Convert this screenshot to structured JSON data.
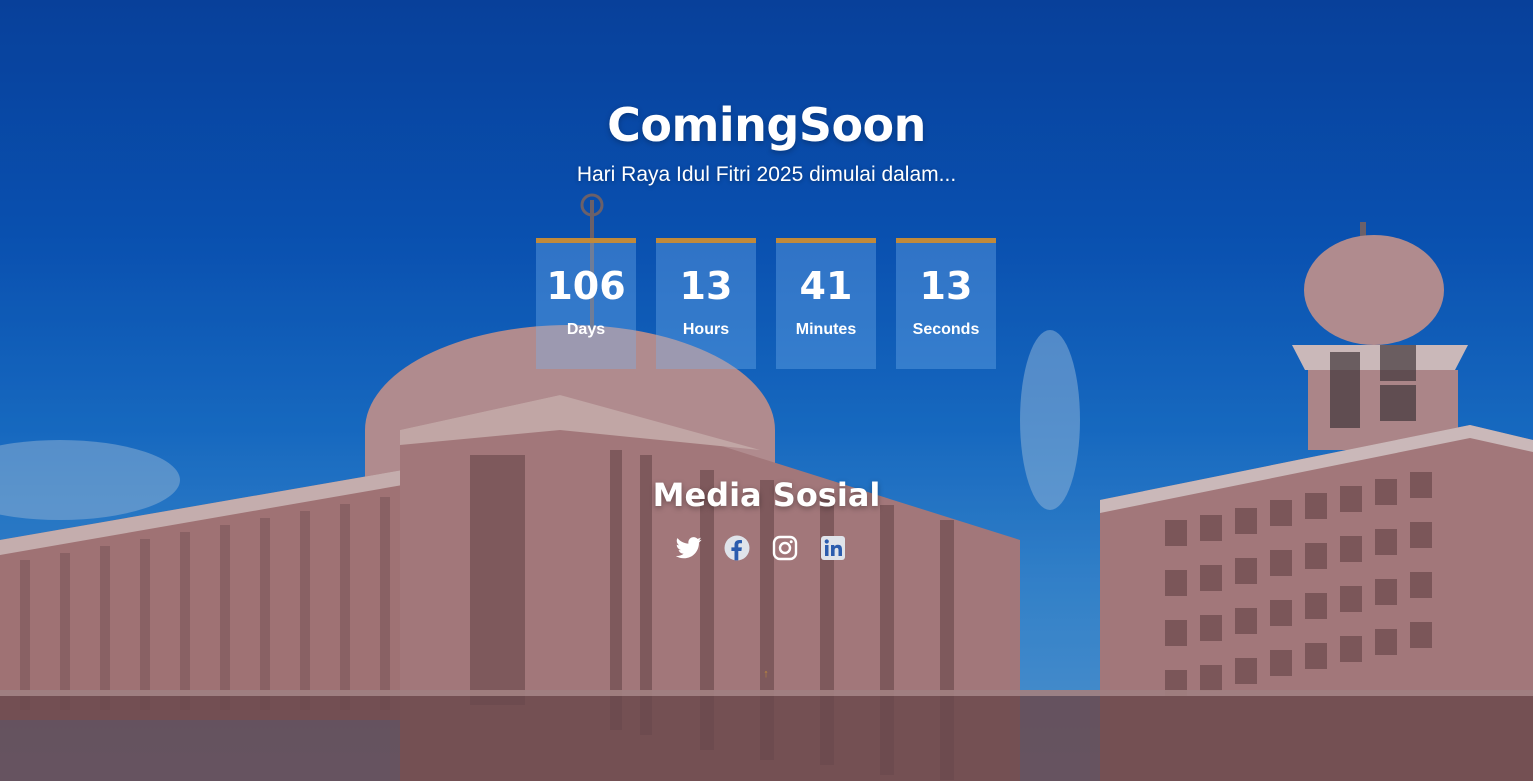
{
  "hero": {
    "title": "ComingSoon",
    "subtitle": "Hari Raya Idul Fitri 2025 dimulai dalam..."
  },
  "countdown": [
    {
      "value": "106",
      "label": "Days"
    },
    {
      "value": "13",
      "label": "Hours"
    },
    {
      "value": "41",
      "label": "Minutes"
    },
    {
      "value": "13",
      "label": "Seconds"
    }
  ],
  "social": {
    "title": "Media Sosial",
    "icons": [
      "twitter-icon",
      "facebook-icon",
      "instagram-icon",
      "linkedin-icon"
    ]
  },
  "scroll_up": {
    "glyph": "↑",
    "color": "#c18a3a"
  },
  "colors": {
    "accent": "#c18a3a",
    "sky": "#0b58c0"
  }
}
